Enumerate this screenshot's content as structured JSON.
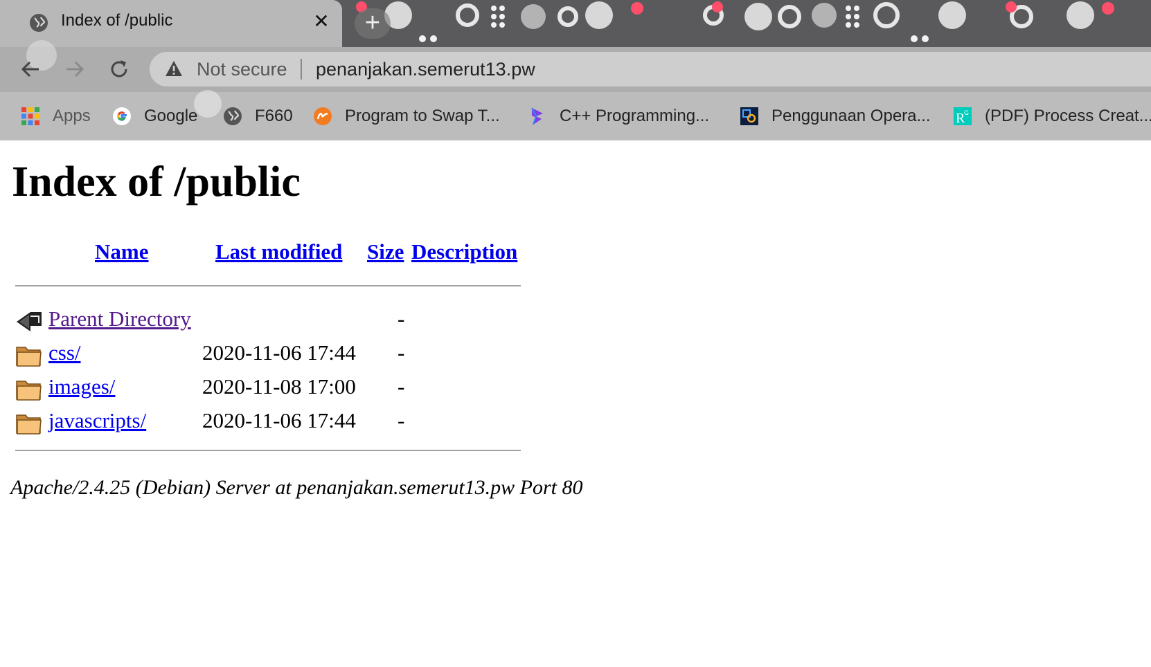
{
  "browser": {
    "tab_title": "Index of /public",
    "tab_close": "✕",
    "new_tab": "+",
    "security_label": "Not secure",
    "url": "penanjakan.semerut13.pw",
    "bookmarks": [
      {
        "label": "Apps",
        "icon": "apps-grid-icon"
      },
      {
        "label": "Google",
        "icon": "google-icon"
      },
      {
        "label": "F660",
        "icon": "globe-icon"
      },
      {
        "label": "Program to Swap T...",
        "icon": "site-logo-icon"
      },
      {
        "label": "C++ Programming...",
        "icon": "bookmark-logo-icon"
      },
      {
        "label": "Penggunaan Opera...",
        "icon": "app-logo-icon"
      },
      {
        "label": "(PDF) Process Creat...",
        "icon": "researchgate-icon"
      }
    ]
  },
  "page": {
    "title": "Index of /public",
    "columns": {
      "name": "Name",
      "last_modified": "Last modified",
      "size": "Size",
      "description": "Description"
    },
    "rows": [
      {
        "name": "Parent Directory",
        "date": "",
        "size": "-",
        "icon": "back-arrow-icon"
      },
      {
        "name": "css/",
        "date": "2020-11-06 17:44",
        "size": "-",
        "icon": "folder-icon"
      },
      {
        "name": "images/",
        "date": "2020-11-08 17:00",
        "size": "-",
        "icon": "folder-icon"
      },
      {
        "name": "javascripts/",
        "date": "2020-11-06 17:44",
        "size": "-",
        "icon": "folder-icon"
      }
    ],
    "footer": "Apache/2.4.25 (Debian) Server at penanjakan.semerut13.pw Port 80"
  },
  "colors": {
    "link": "#0000ee",
    "visited_link": "#551a8b",
    "chrome_theme": "#5a5a5c",
    "accent_pink": "#ff4f6a"
  }
}
